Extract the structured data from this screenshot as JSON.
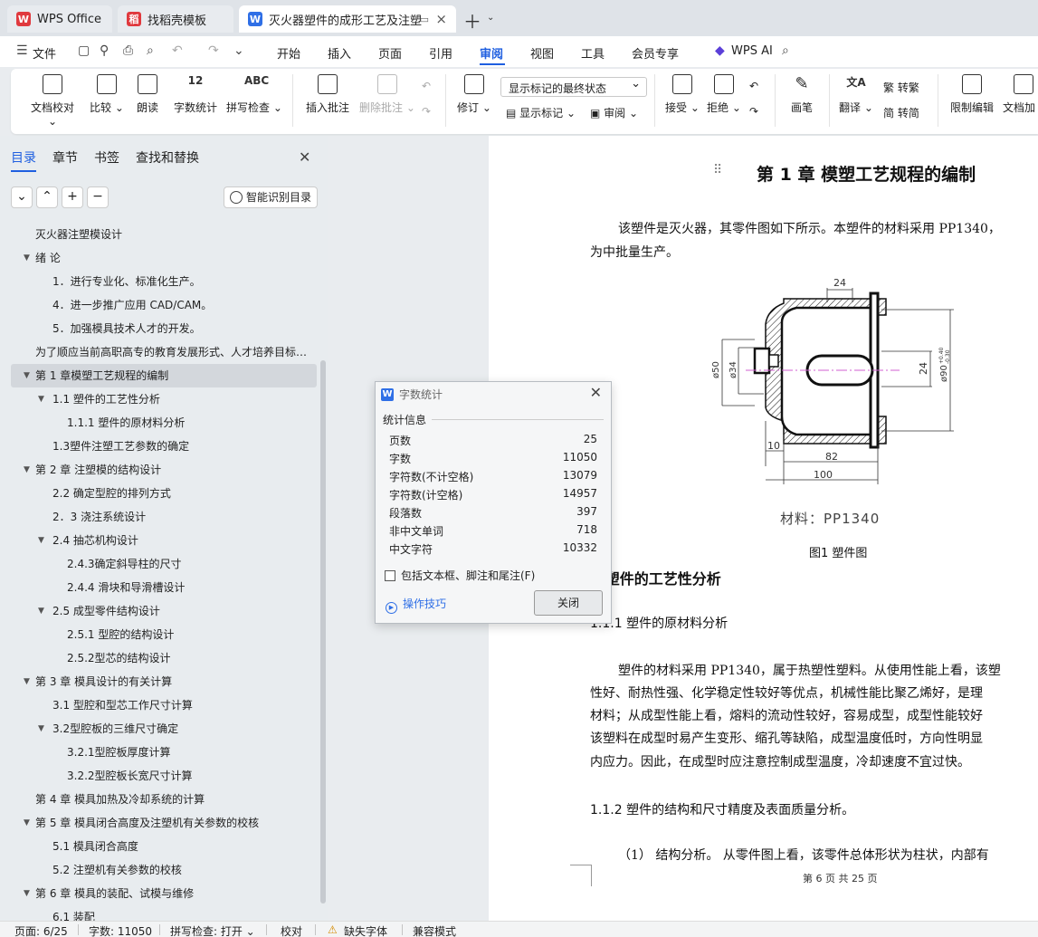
{
  "tabs": [
    {
      "label": "WPS Office",
      "logo": "W"
    },
    {
      "label": "找稻壳模板",
      "logo": "稻"
    },
    {
      "label": "灭火器塑件的成形工艺及注塑",
      "logo": "W"
    }
  ],
  "menu": {
    "file": "文件",
    "items": [
      "开始",
      "插入",
      "页面",
      "引用",
      "审阅",
      "视图",
      "工具",
      "会员专享"
    ],
    "active": "审阅",
    "wps_ai": "WPS AI"
  },
  "ribbon": {
    "doc_check": "文档校对",
    "compare": "比较",
    "read_aloud": "朗读",
    "word_count": "字数统计",
    "spell_check": "拼写检查",
    "insert_comment": "插入批注",
    "delete_comment": "删除批注",
    "revise": "修订",
    "display_mode": "显示标记的最终状态",
    "show_markup": "显示标记",
    "review": "审阅",
    "accept": "接受",
    "reject": "拒绝",
    "brush": "画笔",
    "translate": "翻译",
    "to_trad": "转繁",
    "to_simp": "转简",
    "restrict_edit": "限制编辑",
    "doc_protect": "文档加"
  },
  "nav": {
    "tabs": [
      "目录",
      "章节",
      "书签",
      "查找和替换"
    ],
    "smart_btn": "智能识别目录",
    "toc": [
      {
        "label": "灭火器注塑模设计",
        "level": 0,
        "caret": false
      },
      {
        "label": "绪  论",
        "level": 0,
        "caret": true
      },
      {
        "label": "1．进行专业化、标准化生产。",
        "level": 1,
        "caret": false
      },
      {
        "label": "4．进一步推广应用 CAD/CAM。",
        "level": 1,
        "caret": false
      },
      {
        "label": "5．加强模具技术人才的开发。",
        "level": 1,
        "caret": false
      },
      {
        "label": "为了顺应当前高职高专的教育发展形式、人才培养目标…",
        "level": 0,
        "caret": false
      },
      {
        "label": "第 1 章模塑工艺规程的编制",
        "level": 0,
        "caret": true,
        "selected": true
      },
      {
        "label": "1.1  塑件的工艺性分析",
        "level": 1,
        "caret": true
      },
      {
        "label": "1.1.1    塑件的原材料分析",
        "level": 2,
        "caret": false
      },
      {
        "label": "1.3塑件注塑工艺参数的确定",
        "level": 1,
        "caret": false
      },
      {
        "label": "第 2 章  注塑模的结构设计",
        "level": 0,
        "caret": true
      },
      {
        "label": "2.2  确定型腔的排列方式",
        "level": 1,
        "caret": false
      },
      {
        "label": "2．3  浇注系统设计",
        "level": 1,
        "caret": false
      },
      {
        "label": "2.4  抽芯机构设计",
        "level": 1,
        "caret": true
      },
      {
        "label": "2.4.3确定斜导柱的尺寸",
        "level": 2,
        "caret": false
      },
      {
        "label": "2.4.4  滑块和导滑槽设计",
        "level": 2,
        "caret": false
      },
      {
        "label": "2.5  成型零件结构设计",
        "level": 1,
        "caret": true
      },
      {
        "label": "2.5.1  型腔的结构设计",
        "level": 2,
        "caret": false
      },
      {
        "label": "2.5.2型芯的结构设计",
        "level": 2,
        "caret": false
      },
      {
        "label": "第 3 章  模具设计的有关计算",
        "level": 0,
        "caret": true
      },
      {
        "label": "3.1  型腔和型芯工作尺寸计算",
        "level": 1,
        "caret": false
      },
      {
        "label": "3.2型腔板的三维尺寸确定",
        "level": 1,
        "caret": true
      },
      {
        "label": "3.2.1型腔板厚度计算",
        "level": 2,
        "caret": false
      },
      {
        "label": "3.2.2型腔板长宽尺寸计算",
        "level": 2,
        "caret": false
      },
      {
        "label": "第 4 章  模具加热及冷却系统的计算",
        "level": 0,
        "caret": false
      },
      {
        "label": "第 5 章  模具闭合高度及注塑机有关参数的校核",
        "level": 0,
        "caret": true
      },
      {
        "label": "5.1  模具闭合高度",
        "level": 1,
        "caret": false
      },
      {
        "label": "5.2  注塑机有关参数的校核",
        "level": 1,
        "caret": false
      },
      {
        "label": "第 6 章  模具的装配、试模与维修",
        "level": 0,
        "caret": true
      },
      {
        "label": "6.1  装配",
        "level": 1,
        "caret": false
      }
    ]
  },
  "doc": {
    "chapter_title": "第 1 章  模塑工艺规程的编制",
    "intro_line1": "该塑件是灭火器，其零件图如下所示。本塑件的材料采用 PP1340，",
    "intro_line2": "为中批量生产。",
    "drawing": {
      "dim_top": "24",
      "dim_phi50": "ø50",
      "dim_phi34": "ø34",
      "dim_24": "24",
      "dim_phi90": "ø90",
      "dim_tol_upper": "+0.40",
      "dim_tol_lower": "-0.30",
      "dim_10": "10",
      "dim_82": "82",
      "dim_100": "100"
    },
    "material": "材料：PP1340",
    "figure_caption": "图1  塑件图",
    "section_1_1": "1  塑件的工艺性分析",
    "section_1_1_1": "1.1.1   塑件的原材料分析",
    "body_lines": [
      "塑件的材料采用 PP1340，属于热塑性塑料。从使用性能上看，该塑",
      "性好、耐热性强、化学稳定性较好等优点，机械性能比聚乙烯好，是理",
      "材料；从成型性能上看，熔料的流动性较好，容易成型，成型性能较好",
      "该塑料在成型时易产生变形、缩孔等缺陷，成型温度低时，方向性明显",
      "内应力。因此，在成型时应注意控制成型温度，冷却速度不宜过快。"
    ],
    "section_1_1_2": "1.1.2   塑件的结构和尺寸精度及表面质量分析。",
    "struct_line": "（1）   结构分析。 从零件图上看，该零件总体形状为柱状，内部有",
    "footer": "第 6 页 共 25 页"
  },
  "dialog": {
    "title": "字数统计",
    "section": "统计信息",
    "rows": [
      {
        "label": "页数",
        "value": "25"
      },
      {
        "label": "字数",
        "value": "11050"
      },
      {
        "label": "字符数(不计空格)",
        "value": "13079"
      },
      {
        "label": "字符数(计空格)",
        "value": "14957"
      },
      {
        "label": "段落数",
        "value": "397"
      },
      {
        "label": "非中文单词",
        "value": "718"
      },
      {
        "label": "中文字符",
        "value": "10332"
      }
    ],
    "checkbox": "包括文本框、脚注和尾注(F)",
    "tips": "操作技巧",
    "close": "关闭"
  },
  "status": {
    "page": "页面: 6/25",
    "words": "字数: 11050",
    "spell": "拼写检查: 打开",
    "proof": "校对",
    "missing_font": "缺失字体",
    "compat": "兼容模式"
  },
  "colors": {
    "accent": "#1f5fe0",
    "wps_red": "#e0393e",
    "wps_blue": "#2f6fe6"
  }
}
